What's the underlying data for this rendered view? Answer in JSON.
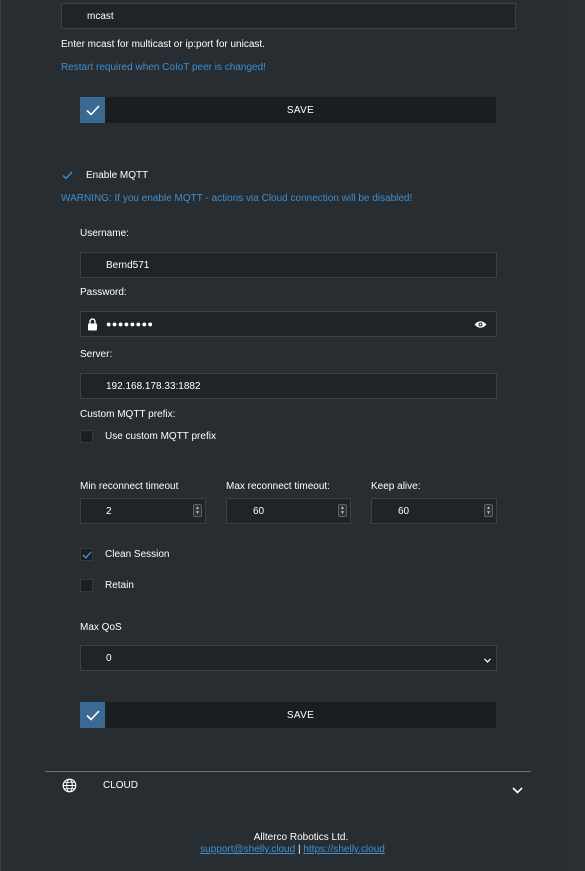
{
  "coiot": {
    "peer_value": "mcast",
    "help_text": "Enter mcast for multicast or ip:port for unicast.",
    "restart_note": "Restart required when CoIoT peer is changed!",
    "save_label": "SAVE"
  },
  "mqtt": {
    "enable_label": "Enable MQTT",
    "enabled": true,
    "warning": "WARNING: If you enable MQTT - actions via Cloud connection will be disabled!",
    "username_label": "Username:",
    "username_value": "Bernd571",
    "password_label": "Password:",
    "password_value": "●●●●●●●●",
    "server_label": "Server:",
    "server_value": "192.168.178.33:1882",
    "prefix_label": "Custom MQTT prefix:",
    "use_custom_prefix_label": "Use custom MQTT prefix",
    "use_custom_prefix": false,
    "min_reconnect_label": "Min reconnect timeout",
    "min_reconnect_value": "2",
    "max_reconnect_label": "Max reconnect timeout:",
    "max_reconnect_value": "60",
    "keep_alive_label": "Keep alive:",
    "keep_alive_value": "60",
    "clean_session_label": "Clean Session",
    "clean_session": true,
    "retain_label": "Retain",
    "retain": false,
    "max_qos_label": "Max QoS",
    "max_qos_value": "0",
    "save_label": "SAVE"
  },
  "cloud_section": {
    "label": "CLOUD",
    "icon": "globe-icon",
    "chevron": "chevron-down-icon"
  },
  "footer": {
    "company": "Allterco Robotics Ltd.",
    "support_email": "support@shelly.cloud",
    "separator": "|",
    "website": "https://shelly.cloud"
  },
  "colors": {
    "background": "#272d30",
    "accent_blue": "#3f8fd2",
    "check_blue": "#3a6a92",
    "input_bg": "#1f2427"
  }
}
